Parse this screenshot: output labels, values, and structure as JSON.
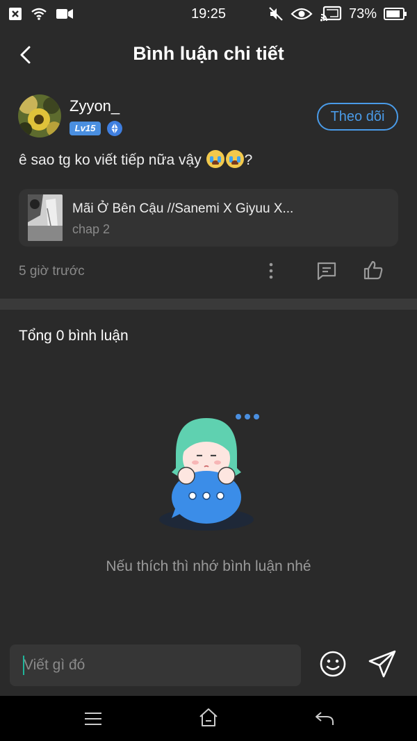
{
  "status_bar": {
    "time": "19:25",
    "battery": "73%"
  },
  "header": {
    "title": "Bình luận chi tiết"
  },
  "post": {
    "username": "Zyyon_",
    "level": "Lv15",
    "follow_label": "Theo dõi",
    "comment_text": "ê sao tg ko viết tiếp nữa vậy",
    "comment_suffix": "?",
    "story_title": "Mãi Ở Bên Cậu //Sanemi X Giyuu X...",
    "story_chapter": "chap 2",
    "time_ago": "5 giờ trước"
  },
  "comments": {
    "total_label": "Tổng 0 bình luận",
    "empty_text": "Nếu thích thì nhớ bình luận nhé"
  },
  "input": {
    "placeholder": "Viết gì đó"
  },
  "colors": {
    "accent": "#4a9be8",
    "background": "#2a2a2a",
    "illustration_hair": "#5fd1b0",
    "illustration_bubble": "#3b8de8"
  },
  "icons": [
    "close-box-icon",
    "wifi-icon",
    "video-icon",
    "mute-icon",
    "eye-icon",
    "cast-icon",
    "battery-icon",
    "back-arrow-icon",
    "gem-icon",
    "more-vertical-icon",
    "reply-icon",
    "thumbs-up-icon",
    "emoji-icon",
    "send-icon",
    "menu-icon",
    "home-icon",
    "nav-back-icon"
  ]
}
